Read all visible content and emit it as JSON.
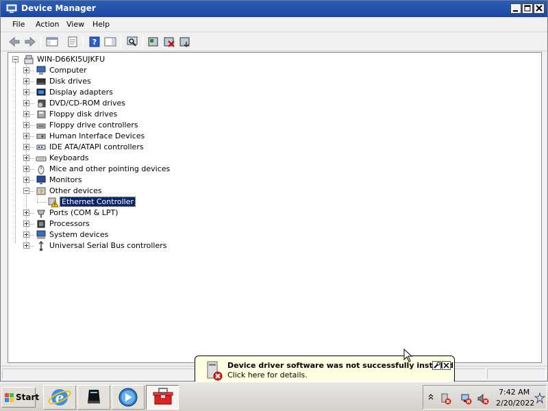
{
  "window": {
    "title": "Device Manager"
  },
  "menu": {
    "items": [
      "File",
      "Action",
      "View",
      "Help"
    ]
  },
  "tree": {
    "root": "WIN-D66KI5UJKFU",
    "categories": [
      {
        "label": "Computer",
        "icon": "computer-icon",
        "expanded": false
      },
      {
        "label": "Disk drives",
        "icon": "disk-drive-icon",
        "expanded": false
      },
      {
        "label": "Display adapters",
        "icon": "display-adapter-icon",
        "expanded": false
      },
      {
        "label": "DVD/CD-ROM drives",
        "icon": "dvd-drive-icon",
        "expanded": false
      },
      {
        "label": "Floppy disk drives",
        "icon": "floppy-drive-icon",
        "expanded": false
      },
      {
        "label": "Floppy drive controllers",
        "icon": "floppy-controller-icon",
        "expanded": false
      },
      {
        "label": "Human Interface Devices",
        "icon": "hid-icon",
        "expanded": false
      },
      {
        "label": "IDE ATA/ATAPI controllers",
        "icon": "ide-controller-icon",
        "expanded": false
      },
      {
        "label": "Keyboards",
        "icon": "keyboard-icon",
        "expanded": false
      },
      {
        "label": "Mice and other pointing devices",
        "icon": "mouse-icon",
        "expanded": false
      },
      {
        "label": "Monitors",
        "icon": "monitor-icon",
        "expanded": false
      },
      {
        "label": "Other devices",
        "icon": "other-devices-icon",
        "expanded": true
      },
      {
        "label": "Ports (COM & LPT)",
        "icon": "port-icon",
        "expanded": false
      },
      {
        "label": "Processors",
        "icon": "processor-icon",
        "expanded": false
      },
      {
        "label": "System devices",
        "icon": "system-devices-icon",
        "expanded": false
      },
      {
        "label": "Universal Serial Bus controllers",
        "icon": "usb-icon",
        "expanded": false
      }
    ],
    "child": {
      "label": "Ethernet Controller",
      "icon": "warning-device-icon",
      "selected": true
    }
  },
  "balloon": {
    "title": "Device driver software was not successfully installed",
    "detail": "Click here for details."
  },
  "taskbar": {
    "start_label": "Start",
    "apps": [
      "internet-explorer-icon",
      "server-manager-icon",
      "media-player-icon",
      "device-manager-toolbox-icon"
    ]
  },
  "clock": {
    "time": "7:42 AM",
    "date": "2/20/2022"
  }
}
